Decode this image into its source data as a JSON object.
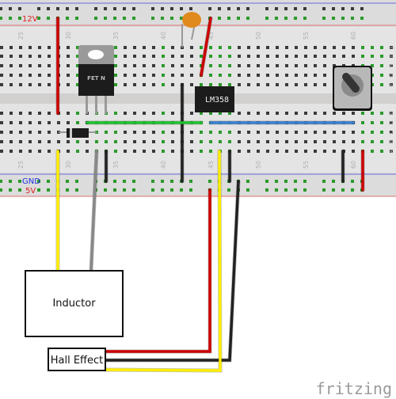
{
  "breadboard": {
    "rail_labels": {
      "top_12v": "12V",
      "bottom_gnd": "GND",
      "bottom_5v": "5V"
    },
    "column_numbers": [
      "25",
      "30",
      "35",
      "40",
      "45",
      "50",
      "55",
      "60"
    ],
    "row_letters_top": [
      "J",
      "I",
      "H",
      "G",
      "F"
    ],
    "row_letters_bottom": [
      "E",
      "D",
      "C",
      "B",
      "A"
    ]
  },
  "components": {
    "mosfet": {
      "label": "FET N"
    },
    "opamp": {
      "label": "LM358"
    },
    "capacitor": {
      "color": "#e08a1e"
    },
    "potentiometer": {},
    "diode": {}
  },
  "modules": {
    "inductor": {
      "label": "Inductor"
    },
    "hall_sensor": {
      "label": "Hall Effect"
    }
  },
  "wire_colors": {
    "red": "#cc0000",
    "yellow": "#ffee00",
    "black": "#222222",
    "gray": "#888888",
    "green": "#22c030",
    "blue": "#3a7fd0"
  },
  "watermark": "fritzing"
}
